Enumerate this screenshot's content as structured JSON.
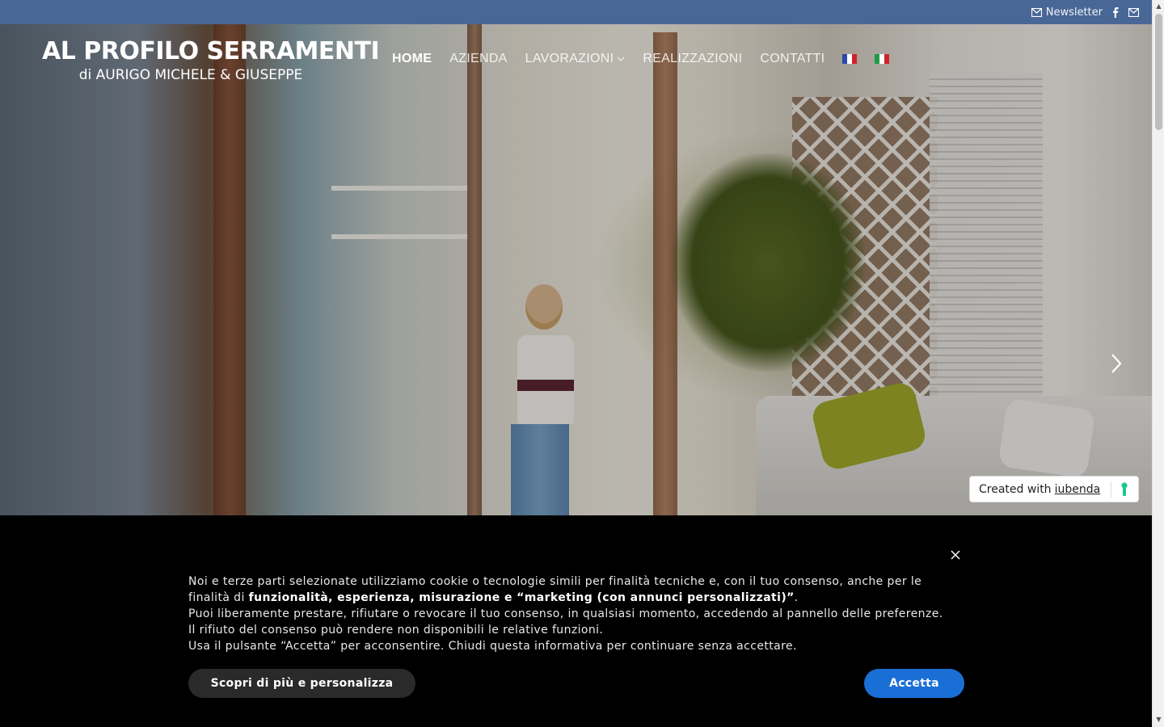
{
  "topbar": {
    "newsletter_label": "Newsletter",
    "icons": [
      "mail-icon",
      "facebook-icon",
      "mail-icon"
    ],
    "bg_color": "#496796"
  },
  "header": {
    "logo_line1": "AL PROFILO SERRAMENTI",
    "logo_line2": "di AURIGO MICHELE & GIUSEPPE",
    "nav": [
      {
        "label": "HOME",
        "active": true
      },
      {
        "label": "AZIENDA"
      },
      {
        "label": "LAVORAZIONI",
        "has_dropdown": true
      },
      {
        "label": "REALIZZAZIONI"
      },
      {
        "label": "CONTATTI"
      }
    ],
    "languages": [
      "french-flag-icon",
      "italian-flag-icon"
    ]
  },
  "slider": {
    "next_icon": "chevron-right-icon"
  },
  "iubenda_badge": {
    "prefix": "Created with",
    "link": "iubenda"
  },
  "cookie_banner": {
    "line1": "Noi e terze parti selezionate utilizziamo cookie o tecnologie simili per finalità tecniche e, con il tuo consenso, anche per le finalità di",
    "line2_bold": "funzionalità, esperienza, misurazione e “marketing (con annunci personalizzati)”",
    "line2_end": ".",
    "line3": "Puoi liberamente prestare, rifiutare o revocare il tuo consenso, in qualsiasi momento, accedendo al pannello delle preferenze. Il rifiuto del consenso può rendere non disponibili le relative funzioni.",
    "line4": "Usa il pulsante “Accetta” per acconsentire. Chiudi questa informativa per continuare senza accettare.",
    "more_button": "Scopri di più e personalizza",
    "accept_button": "Accetta",
    "accept_color": "#1a6fd6"
  }
}
